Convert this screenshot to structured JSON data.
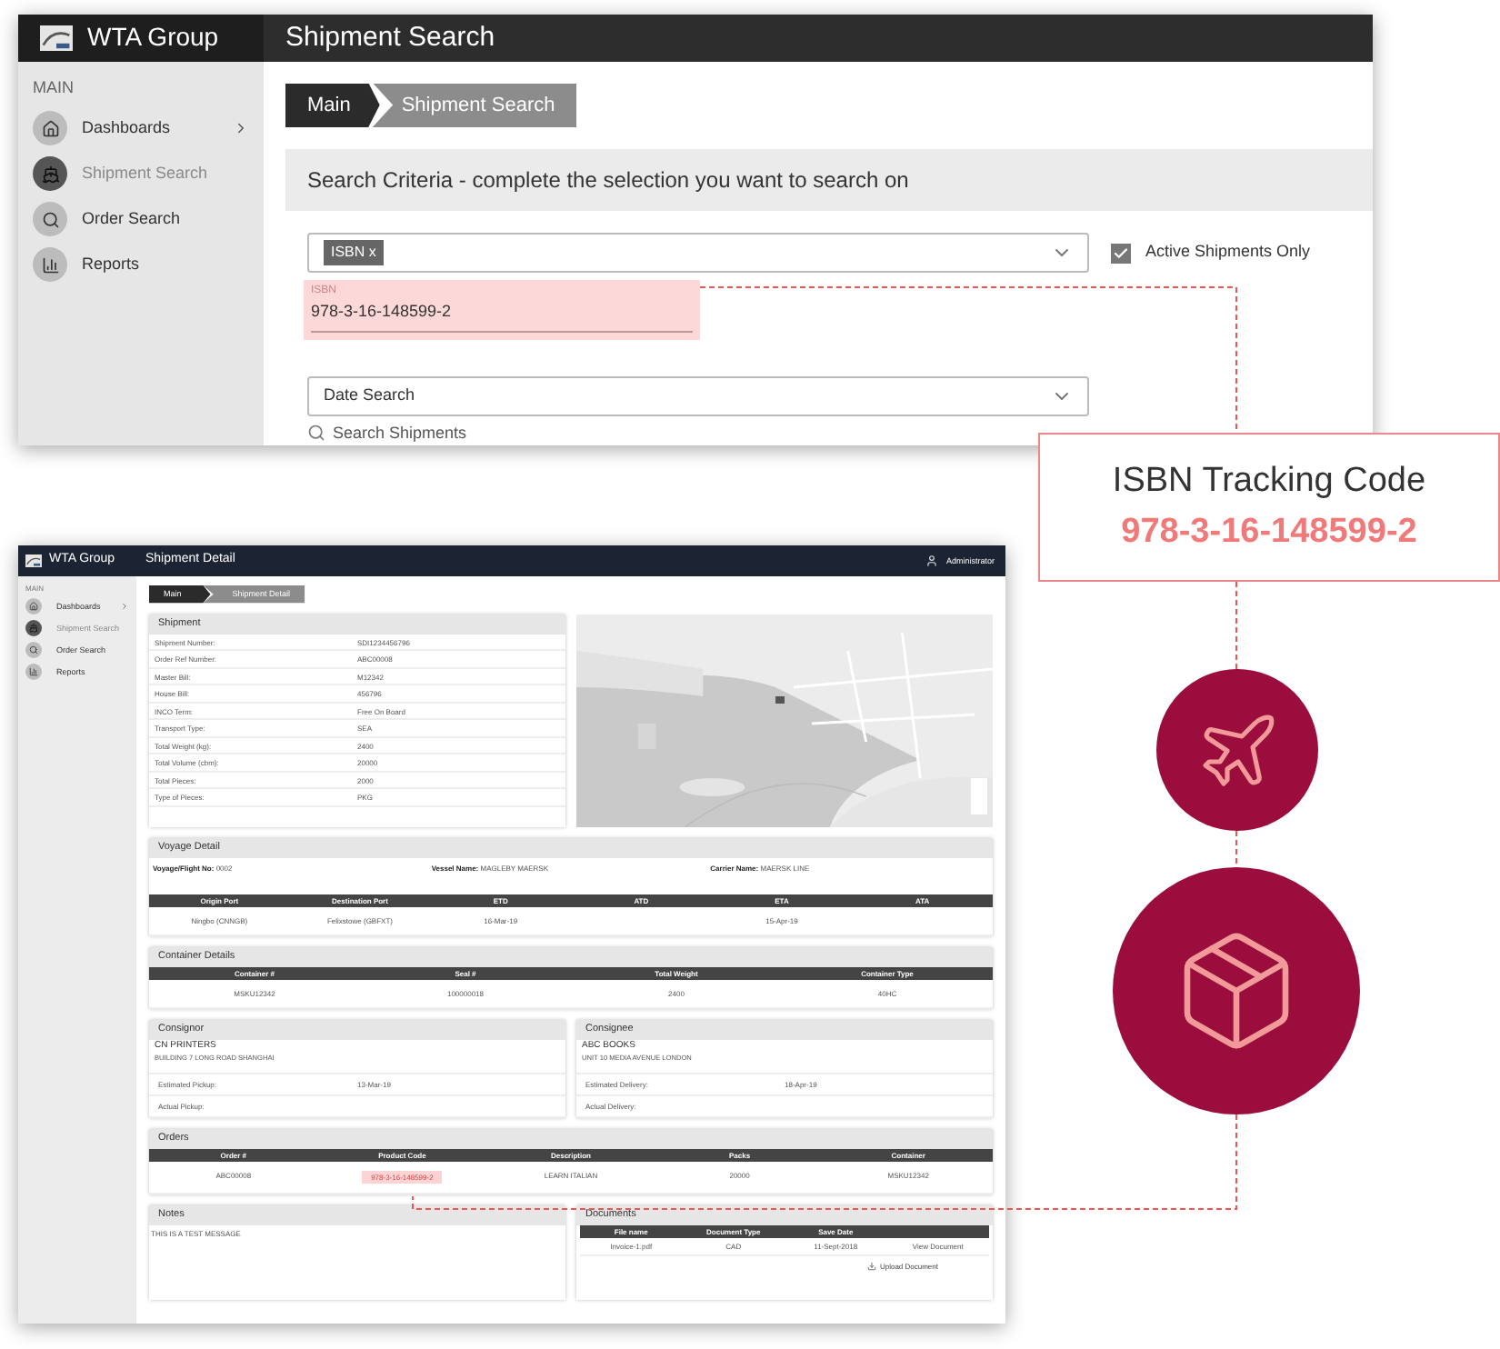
{
  "search_screen": {
    "app_name": "WTA Group",
    "title": "Shipment Search",
    "sidebar": {
      "section": "MAIN",
      "items": [
        {
          "label": "Dashboards",
          "selected": false,
          "expandable": true
        },
        {
          "label": "Shipment Search",
          "selected": true,
          "expandable": false
        },
        {
          "label": "Order Search",
          "selected": false,
          "expandable": false
        },
        {
          "label": "Reports",
          "selected": false,
          "expandable": false
        }
      ]
    },
    "breadcrumb": [
      "Main",
      "Shipment Search"
    ],
    "criteria_title": "Search Criteria - complete the selection you want to search on",
    "criteria_field": {
      "tags": [
        {
          "label": "ISBN",
          "remove": "x"
        }
      ]
    },
    "active_only": {
      "label": "Active Shipments Only",
      "checked": true
    },
    "isbn_field": {
      "label": "ISBN",
      "value": "978-3-16-148599-2"
    },
    "date_field": {
      "value": "Date Search"
    },
    "search_button": "Search Shipments"
  },
  "callout": {
    "title": "ISBN Tracking Code",
    "code": "978-3-16-148599-2"
  },
  "detail_screen": {
    "app_name": "WTA Group",
    "title": "Shipment Detail",
    "user": "Administrator",
    "sidebar": {
      "section": "MAIN",
      "items": [
        {
          "label": "Dashboards",
          "selected": false,
          "expandable": true
        },
        {
          "label": "Shipment Search",
          "selected": true,
          "expandable": false
        },
        {
          "label": "Order Search",
          "selected": false,
          "expandable": false
        },
        {
          "label": "Reports",
          "selected": false,
          "expandable": false
        }
      ]
    },
    "breadcrumb": [
      "Main",
      "Shipment Detail"
    ],
    "shipment": {
      "title": "Shipment",
      "rows": [
        {
          "label": "Shipment Number:",
          "value": "SDI1234456796"
        },
        {
          "label": "Order Ref Number:",
          "value": "ABC00008"
        },
        {
          "label": "Master Bill:",
          "value": "M12342"
        },
        {
          "label": "House Bill:",
          "value": "456796"
        },
        {
          "label": "INCO Term:",
          "value": "Free On Board"
        },
        {
          "label": "Transport Type:",
          "value": "SEA"
        },
        {
          "label": "Total Weight (kg):",
          "value": "2400"
        },
        {
          "label": "Total Volume (cbm):",
          "value": "20000"
        },
        {
          "label": "Total Pieces:",
          "value": "2000"
        },
        {
          "label": "Type of Pieces:",
          "value": "PKG"
        }
      ]
    },
    "map": {
      "kind": "picture"
    },
    "voyage": {
      "title": "Voyage Detail",
      "fields": [
        {
          "label": "Voyage/Flight No:",
          "value": "0002"
        },
        {
          "label": "Vessel Name:",
          "value": "MAGLEBY MAERSK"
        },
        {
          "label": "Carrier Name:",
          "value": "MAERSK LINE"
        }
      ],
      "columns": [
        "Origin Port",
        "Destination Port",
        "ETD",
        "ATD",
        "ETA",
        "ATA"
      ],
      "rows": [
        [
          "Ningbo (CNNGB)",
          "Felixstowe (GBFXT)",
          "16-Mar-19",
          null,
          "15-Apr-19",
          null
        ]
      ]
    },
    "containers": {
      "title": "Container Details",
      "columns": [
        "Container #",
        "Seal #",
        "Total Weight",
        "Container Type"
      ],
      "rows": [
        [
          "MSKU12342",
          "100000018",
          "2400",
          "40HC"
        ]
      ]
    },
    "parties": [
      {
        "title": "Consignor",
        "name": "CN PRINTERS",
        "address": "BUILDING 7 LONG ROAD SHANGHAI",
        "rows": [
          {
            "label": "Estimated Pickup:",
            "value": "13-Mar-19"
          },
          {
            "label": "Actual Pickup:"
          }
        ]
      },
      {
        "title": "Consignee",
        "name": "ABC BOOKS",
        "address": "UNIT 10 MEDIA AVENUE LONDON",
        "rows": [
          {
            "label": "Estimated Delivery:",
            "value": "18-Apr-19"
          },
          {
            "label": "Actual Delivery:"
          }
        ]
      }
    ],
    "orders": {
      "title": "Orders",
      "columns": [
        "Order #",
        "Product Code",
        "Description",
        "Packs",
        "Container"
      ],
      "rows": [
        [
          {
            "text": "ABC00008",
            "highlighted": false
          },
          {
            "text": "978-3-16-148599-2",
            "highlighted": true
          },
          {
            "text": "LEARN ITALIAN",
            "highlighted": false
          },
          {
            "text": "20000",
            "highlighted": false
          },
          {
            "text": "MSKU12342",
            "highlighted": false
          }
        ]
      ]
    },
    "notes": {
      "title": "Notes",
      "text": "THIS IS A TEST MESSAGE"
    },
    "documents": {
      "title": "Documents",
      "columns": [
        "File name",
        "Document Type",
        "Save Date"
      ],
      "rows": [
        {
          "cells": [
            "Invoice-1.pdf",
            "CAD",
            "11-Sept-2018"
          ],
          "link": "View Document"
        }
      ],
      "upload": "Upload Document"
    }
  }
}
